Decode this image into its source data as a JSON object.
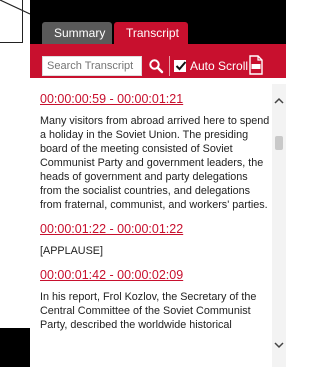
{
  "tabs": {
    "summary": "Summary",
    "transcript": "Transcript"
  },
  "toolbar": {
    "search_placeholder": "Search Transcript",
    "search_value": "",
    "search_icon": "magnifier-icon",
    "autoscroll_label": "Auto Scroll",
    "autoscroll_checked": true,
    "pdf_icon": "pdf-document-icon"
  },
  "transcript": [
    {
      "timestamp": "00:00:00:59 - 00:00:01:21",
      "text": "Many visitors from abroad arrived here to spend a holiday in the Soviet Union. The presiding board of the meeting consisted of Soviet Communist Party and government leaders, the heads of government and party delegations from the socialist countries, and delegations from fraternal, communist, and workers' parties."
    },
    {
      "timestamp": "00:00:01:22 - 00:00:01:22",
      "text": "[APPLAUSE]"
    },
    {
      "timestamp": "00:00:01:42 - 00:00:02:09",
      "text": "In his report, Frol Kozlov, the Secretary of the Central Committee of the Soviet Communist Party, described the worldwide historical"
    }
  ],
  "colors": {
    "accent": "#c8102e",
    "tab_inactive": "#5a5a5a",
    "panel_bg": "#000000"
  }
}
